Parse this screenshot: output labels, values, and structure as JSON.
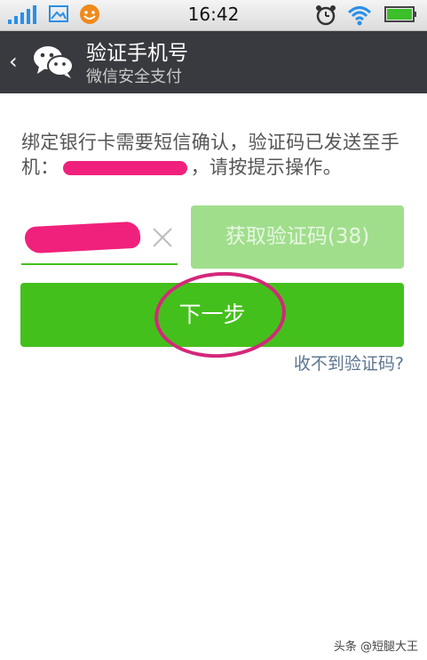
{
  "status_bar": {
    "time": "16:42",
    "icons": [
      "signal-icon",
      "image-icon",
      "notification-icon",
      "alarm-icon",
      "wifi-icon",
      "battery-icon"
    ]
  },
  "header": {
    "back_icon": "chevron-left-icon",
    "logo_icon": "wechat-icon",
    "title": "验证手机号",
    "subtitle": "微信安全支付"
  },
  "main": {
    "info_text_part1": "绑定银行卡需要短信确认，验证码已发送至手机：",
    "info_text_part2": "，请按提示操作。",
    "get_code_label": "获取验证码(38)",
    "next_label": "下一步",
    "no_code_link": "收不到验证码?"
  },
  "watermark": "头条 @短腿大王",
  "colors": {
    "title_bar_bg": "#393a3f",
    "primary_green": "#44c01c",
    "disabled_green": "#a0de8c",
    "link_blue": "#5d7590",
    "redaction_pink": "#f0217c"
  }
}
